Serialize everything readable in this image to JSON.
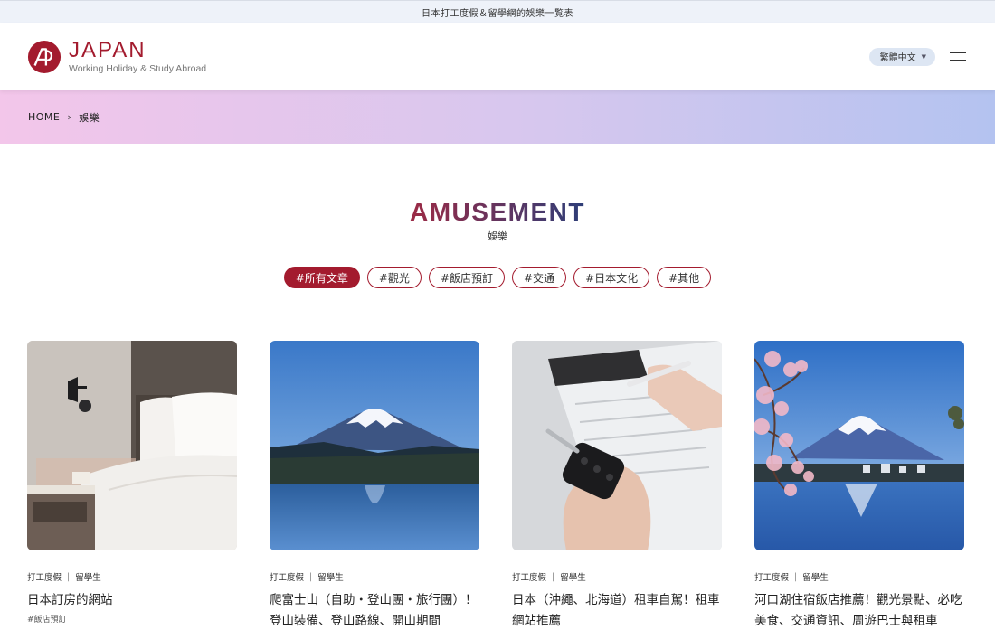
{
  "topbar": {
    "text": "日本打工度假＆留學網的娛樂一覧表"
  },
  "header": {
    "logo_title": "JAPAN",
    "logo_subtitle": "Working Holiday & Study Abroad",
    "lang_selected": "繁體中文",
    "brand_color": "#a31b2e"
  },
  "breadcrumb": {
    "home": "HOME",
    "current": "娛樂"
  },
  "section": {
    "title_en": "AMUSEMENT",
    "title_zh": "娛樂"
  },
  "tags": [
    {
      "label": "#所有文章",
      "active": true
    },
    {
      "label": "#觀光",
      "active": false
    },
    {
      "label": "#飯店預訂",
      "active": false
    },
    {
      "label": "#交通",
      "active": false
    },
    {
      "label": "#日本文化",
      "active": false
    },
    {
      "label": "#其他",
      "active": false
    }
  ],
  "cards": [
    {
      "cat1": "打工度假",
      "cat2": "留學生",
      "title": "日本訂房的網站",
      "tag": "#飯店預訂",
      "image": "hotel-bed"
    },
    {
      "cat1": "打工度假",
      "cat2": "留學生",
      "title": "爬富士山（自助・登山團・旅行團）！登山裝備、登山路線、開山期間",
      "tag": "",
      "image": "mount-fuji-lake"
    },
    {
      "cat1": "打工度假",
      "cat2": "留學生",
      "title": "日本（沖繩、北海道）租車自駕！租車網站推薦",
      "tag": "",
      "image": "car-key-contract"
    },
    {
      "cat1": "打工度假",
      "cat2": "留學生",
      "title": "河口湖住宿飯店推薦！觀光景點、必吃美食、交通資訊、周遊巴士與租車",
      "tag": "",
      "image": "fuji-cherry-blossom"
    }
  ]
}
